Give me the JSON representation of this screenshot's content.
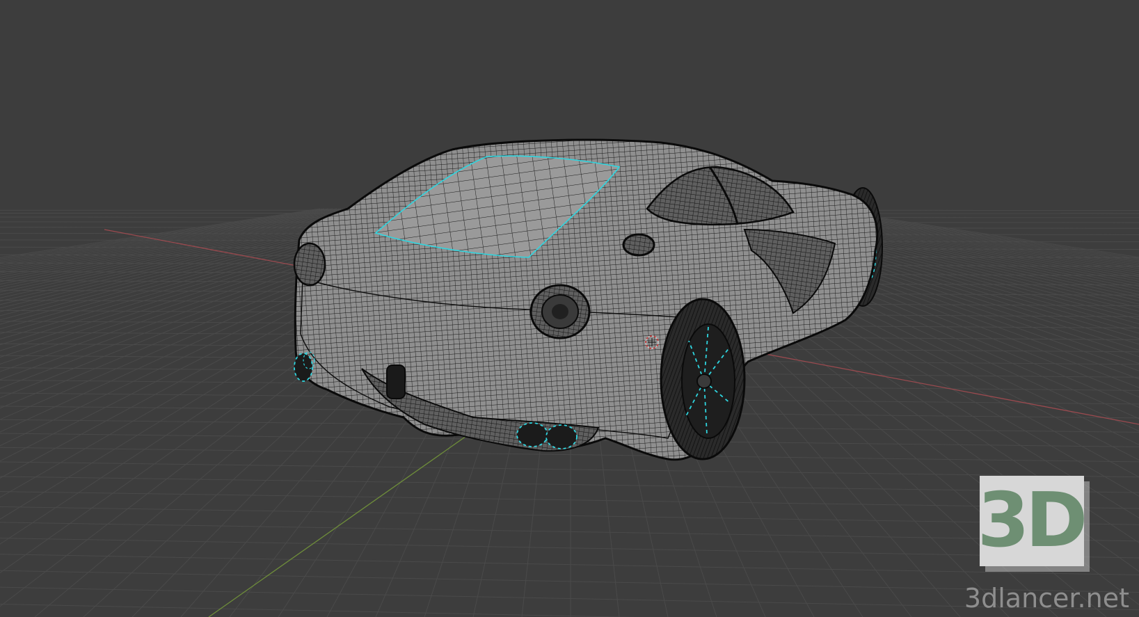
{
  "viewport": {
    "background_color": "#3d3d3d",
    "grid_color": "#4a4a4a",
    "x_axis_color": "#9a4a4f",
    "y_axis_color": "#6e8d3a",
    "wire_color": "#111111",
    "surface_color": "#8a8a8a",
    "highlight_color": "#2fd6e0"
  },
  "model": {
    "name": "car-wireframe",
    "shading": "wireframe-overlay"
  },
  "watermark": {
    "badge_text": "3D",
    "badge_color": "#6e8f73",
    "site_text": "3dlancer.net"
  }
}
